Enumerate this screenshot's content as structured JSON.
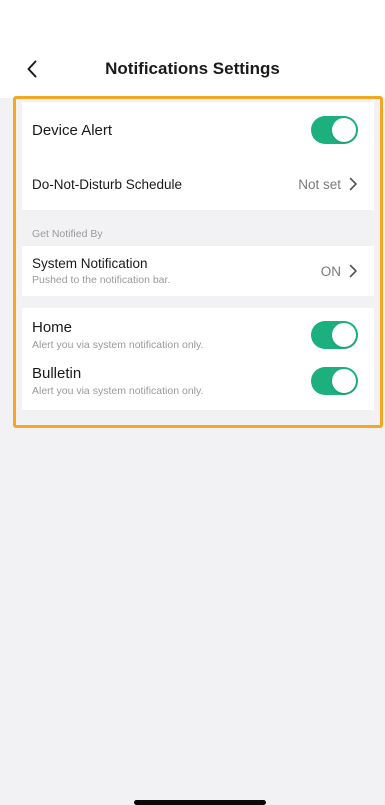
{
  "header": {
    "title": "Notifications Settings",
    "back_icon": "chevron-left-icon"
  },
  "device_alert": {
    "label": "Device Alert",
    "enabled": true
  },
  "dnd_schedule": {
    "label": "Do-Not-Disturb Schedule",
    "value": "Not set"
  },
  "get_notified_by": {
    "section_label": "Get Notified By",
    "system_notification": {
      "label": "System Notification",
      "sublabel": "Pushed to the notification bar.",
      "value": "ON"
    }
  },
  "channels": {
    "home": {
      "label": "Home",
      "sublabel": "Alert you via system notification only.",
      "enabled": true
    },
    "bulletin": {
      "label": "Bulletin",
      "sublabel": "Alert you via system notification only.",
      "enabled": true
    }
  },
  "colors": {
    "accent": "#1cb07f",
    "highlight": "#f5a623"
  }
}
